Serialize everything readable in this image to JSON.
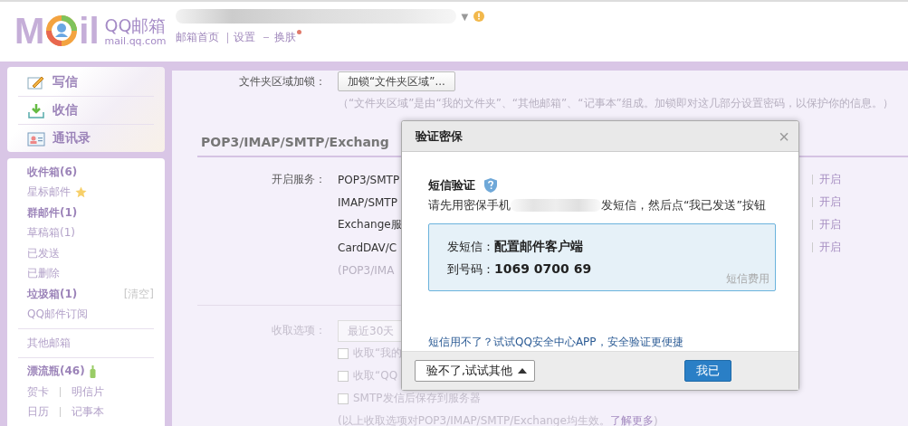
{
  "header": {
    "logo": {
      "left": "M",
      "right": "il",
      "name": "QQ邮箱",
      "domain": "mail.qq.com"
    },
    "account": {
      "caret": "▼"
    },
    "links": [
      {
        "label": "邮箱首页"
      },
      {
        "label": "设置"
      },
      {
        "label": "换肤",
        "badge": true
      }
    ]
  },
  "sidebar": {
    "actions": [
      {
        "label": "写信",
        "kind": "compose"
      },
      {
        "label": "收信",
        "kind": "receive"
      },
      {
        "label": "通讯录",
        "kind": "contacts"
      }
    ],
    "groups": [
      [
        {
          "label": "收件箱(6)",
          "unread": true,
          "kind": "plain"
        },
        {
          "label": "星标邮件",
          "unread": false,
          "kind": "starred"
        },
        {
          "label": "群邮件(1)",
          "unread": true,
          "kind": "plain"
        },
        {
          "label": "草稿箱(1)",
          "unread": false,
          "kind": "plain"
        },
        {
          "label": "已发送",
          "unread": false,
          "kind": "plain"
        },
        {
          "label": "已删除",
          "unread": false,
          "kind": "plain"
        },
        {
          "label": "垃圾箱(1)",
          "unread": true,
          "kind": "plain",
          "action": "[清空]"
        },
        {
          "label": "QQ邮件订阅",
          "unread": false,
          "kind": "plain"
        }
      ],
      [
        {
          "label": "其他邮箱",
          "unread": false,
          "kind": "plain"
        }
      ],
      [
        {
          "label": "漂流瓶(46)",
          "unread": true,
          "kind": "bottle"
        },
        {
          "kind": "pair",
          "links": [
            "贺卡",
            "明信片"
          ]
        },
        {
          "kind": "pair",
          "links": [
            "日历",
            "记事本"
          ]
        }
      ]
    ]
  },
  "settings": {
    "folder_lock": {
      "label": "文件夹区域加锁：",
      "button": "加锁“文件夹区域”...",
      "note": "（“文件夹区域”是由“我的文件夹”、“其他邮箱”、“记事本”组成。加锁即对这几部分设置密码，以保护你的信息。）"
    },
    "section_title": "POP3/IMAP/SMTP/Exchang",
    "services": {
      "label": "开启服务：",
      "rows": [
        {
          "name": "POP3/SMTP",
          "action": "开启"
        },
        {
          "name": "IMAP/SMTP",
          "action": "开启"
        },
        {
          "name": "Exchange服",
          "action": "开启"
        },
        {
          "name": "CardDAV/C",
          "action": "开启"
        }
      ],
      "note": "(POP3/IMA"
    },
    "receive": {
      "label": "收取选项：",
      "disabled": true,
      "select": "最近30天",
      "options": [
        {
          "label": "收取“我的",
          "checked": false
        },
        {
          "label": "收取“QQ",
          "checked": false
        },
        {
          "label": "SMTP发信后保存到服务器",
          "checked": false
        }
      ],
      "note": "(以上收取选项对POP3/IMAP/SMTP/Exchange均生效。",
      "link": "了解更多",
      "note_end": ")"
    }
  },
  "dialog": {
    "title": "验证密保",
    "close": "×",
    "heading": "短信验证",
    "instruction_start": "请先用密保手机",
    "instruction_end": "发短信，然后点“我已发送”按钮",
    "sms": {
      "content": "发短信：**配置邮件客户端**",
      "number": "到号码：**1069 0700 69**",
      "fee": "短信费用"
    },
    "help_link": "短信用不了？试试QQ安全中心APP，安全验证更便捷",
    "buttons": [
      {
        "label": "验不了,试试其他",
        "kind": "menu"
      },
      {
        "label": "我已",
        "kind": "primary"
      }
    ]
  }
}
